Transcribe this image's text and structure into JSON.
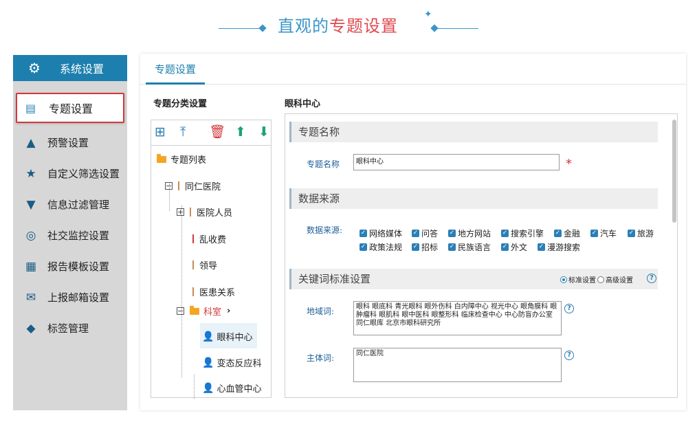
{
  "banner": {
    "title_prefix": "直观的",
    "title_main": "专题设置"
  },
  "sidebar": {
    "header": "系统设置",
    "active": "专题设置",
    "items": [
      {
        "label": "预警设置",
        "icon": "warning-icon"
      },
      {
        "label": "自定义筛选设置",
        "icon": "star-icon"
      },
      {
        "label": "信息过滤管理",
        "icon": "filter-icon"
      },
      {
        "label": "社交监控设置",
        "icon": "webcam-icon"
      },
      {
        "label": "报告模板设置",
        "icon": "template-icon"
      },
      {
        "label": "上报邮箱设置",
        "icon": "mail-icon"
      },
      {
        "label": "标签管理",
        "icon": "tag-icon"
      }
    ]
  },
  "main": {
    "tab": "专题设置",
    "tree_title": "专题分类设置",
    "form_title": "眼科中心",
    "tree": {
      "root": "专题列表",
      "hospital": "同仁医院",
      "children": [
        "医院人员",
        "乱收费",
        "领导",
        "医患关系"
      ],
      "dept": "科室",
      "dept_children": [
        "眼科中心",
        "变态反应科",
        "心血管中心"
      ]
    },
    "form": {
      "section_name": "专题名称",
      "name_label": "专题名称",
      "name_value": "眼科中心",
      "required_mark": "*",
      "section_source": "数据来源",
      "source_label": "数据来源:",
      "sources_row1": [
        "网络媒体",
        "问答",
        "地方网站",
        "搜索引擎",
        "金融",
        "汽车",
        "旅游"
      ],
      "sources_row2": [
        "政策法规",
        "招标",
        "民族语言",
        "外文",
        "漫游搜索"
      ],
      "section_keyword": "关键词标准设置",
      "mode_standard": "标准设置",
      "mode_advanced": "高级设置",
      "region_label": "地域词:",
      "region_value": "眼科 眼底科 青光眼科 眼外伤科 白内障中心 视光中心 眼角膜科 眼肿瘤科 眼肌科 眼中医科 眼整形科 临床检查中心 中心防盲办公室 同仁眼库 北京市眼科研究所",
      "subject_label": "主体词:",
      "subject_value": "同仁医院",
      "help": "?"
    }
  }
}
